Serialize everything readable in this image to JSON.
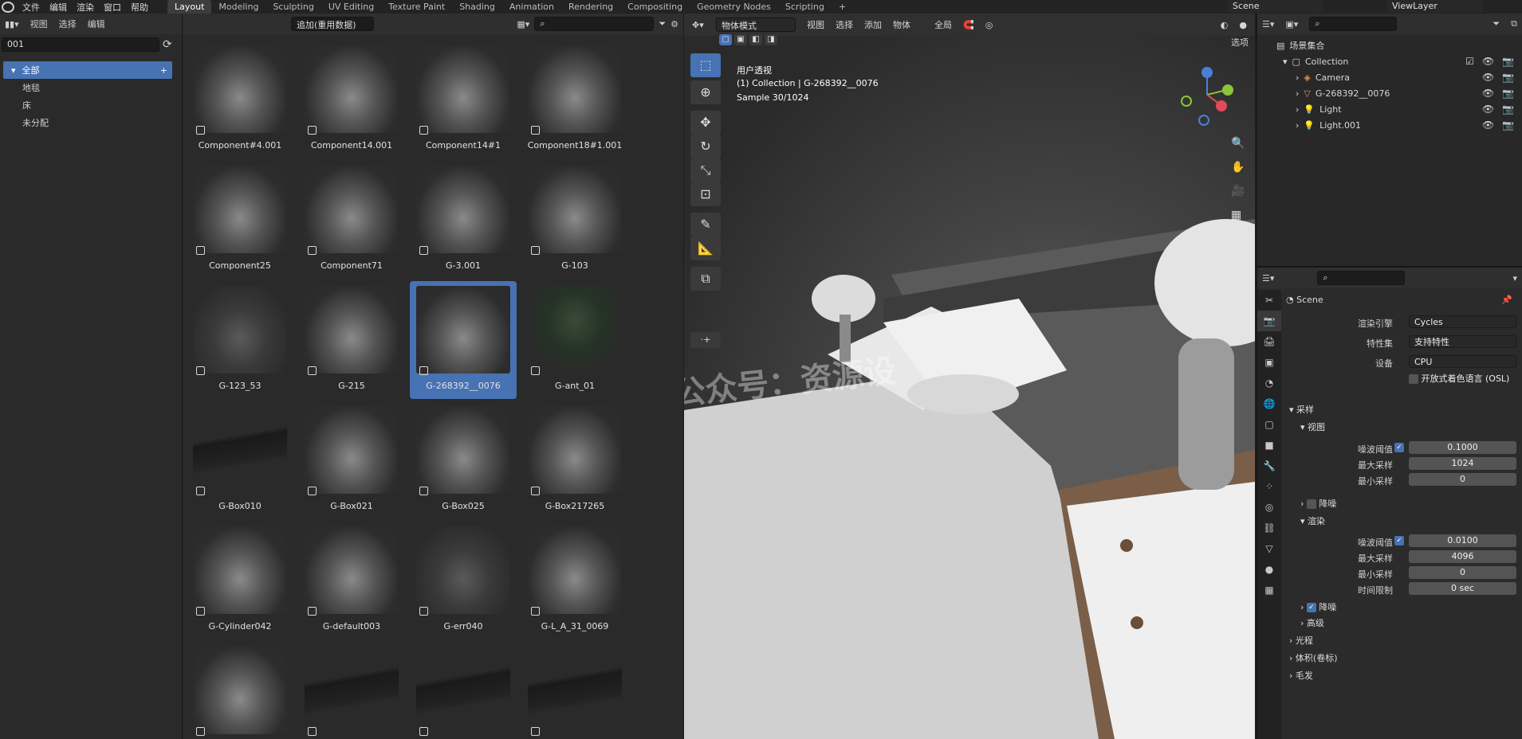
{
  "menubar": {
    "items": [
      "文件",
      "编辑",
      "渲染",
      "窗口",
      "帮助"
    ],
    "workspaces": [
      "Layout",
      "Modeling",
      "Sculpting",
      "UV Editing",
      "Texture Paint",
      "Shading",
      "Animation",
      "Rendering",
      "Compositing",
      "Geometry Nodes",
      "Scripting"
    ],
    "active_workspace": "Layout",
    "scene": "Scene",
    "view_layer": "ViewLayer"
  },
  "asset_browser": {
    "header_menus": [
      "视图",
      "选择",
      "编辑"
    ],
    "import_mode": "追加(重用数据)",
    "library": "001",
    "categories": [
      {
        "label": "全部",
        "selected": true
      },
      {
        "label": "地毯",
        "selected": false
      },
      {
        "label": "床",
        "selected": false
      },
      {
        "label": "未分配",
        "selected": false
      }
    ],
    "assets": [
      {
        "name": "Component#4.001",
        "style": "normal"
      },
      {
        "name": "Component14.001",
        "style": "normal"
      },
      {
        "name": "Component14#1",
        "style": "normal"
      },
      {
        "name": "Component18#1.001",
        "style": "normal"
      },
      {
        "name": "Component25",
        "style": "normal"
      },
      {
        "name": "Component71",
        "style": "normal"
      },
      {
        "name": "G-3.001",
        "style": "normal"
      },
      {
        "name": "G-103",
        "style": "normal"
      },
      {
        "name": "G-123_53",
        "style": "dark"
      },
      {
        "name": "G-215",
        "style": "normal"
      },
      {
        "name": "G-268392__0076",
        "style": "normal",
        "selected": true
      },
      {
        "name": "G-ant_01",
        "style": "plant"
      },
      {
        "name": "G-Box010",
        "style": "rug"
      },
      {
        "name": "G-Box021",
        "style": "normal"
      },
      {
        "name": "G-Box025",
        "style": "normal"
      },
      {
        "name": "G-Box217265",
        "style": "normal"
      },
      {
        "name": "G-Cylinder042",
        "style": "normal"
      },
      {
        "name": "G-default003",
        "style": "normal"
      },
      {
        "name": "G-err040",
        "style": "dark"
      },
      {
        "name": "G-L_A_31_0069",
        "style": "normal"
      },
      {
        "name": "",
        "style": "normal"
      },
      {
        "name": "",
        "style": "rug"
      },
      {
        "name": "",
        "style": "rug"
      },
      {
        "name": "",
        "style": "rug"
      }
    ]
  },
  "viewport": {
    "mode": "物体模式",
    "menus": [
      "视图",
      "选择",
      "添加",
      "物体"
    ],
    "transform_orientation": "全局",
    "options_label": "选项",
    "overlay_view_name": "用户透视",
    "overlay_collection": "(1) Collection | G-268392__0076",
    "overlay_sample": "Sample 30/1024",
    "watermark": "微信公众号：资源设"
  },
  "outliner": {
    "root": "场景集合",
    "collection": "Collection",
    "objects": [
      "Camera",
      "G-268392__0076",
      "Light",
      "Light.001"
    ]
  },
  "properties": {
    "scene_name": "Scene",
    "render_engine_label": "渲染引擎",
    "render_engine": "Cycles",
    "feature_set_label": "特性集",
    "feature_set": "支持特性",
    "device_label": "设备",
    "device": "CPU",
    "osl_label": "开放式着色语言 (OSL)",
    "sampling": {
      "title": "采样",
      "viewport_title": "视图",
      "viewport": {
        "noise_threshold_label": "噪波阈值",
        "noise_threshold": "0.1000",
        "max_samples_label": "最大采样",
        "max_samples": "1024",
        "min_samples_label": "最小采样",
        "min_samples": "0"
      },
      "denoise_label": "降噪",
      "render_title": "渲染",
      "render": {
        "noise_threshold_label": "噪波阈值",
        "noise_threshold": "0.0100",
        "max_samples_label": "最大采样",
        "max_samples": "4096",
        "min_samples_label": "最小采样",
        "min_samples": "0",
        "time_limit_label": "时间限制",
        "time_limit": "0 sec"
      },
      "render_denoise_label": "降噪",
      "advanced_label": "高级"
    },
    "panels": [
      "光程",
      "体积(卷标)",
      "毛发"
    ]
  },
  "colors": {
    "accent": "#4772b3",
    "bg": "#2a2a2a"
  }
}
